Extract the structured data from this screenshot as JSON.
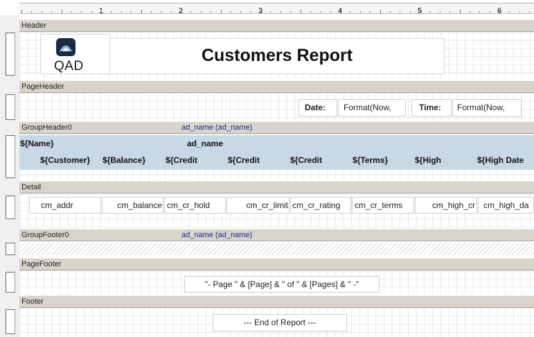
{
  "ruler": {
    "numbers": [
      "1",
      "2",
      "3",
      "4",
      "5",
      "6"
    ]
  },
  "sections": {
    "header": "Header",
    "page_header": "PageHeader",
    "group_header": "GroupHeader0",
    "group_header_expr": "ad_name (ad_name)",
    "detail": "Detail",
    "group_footer": "GroupFooter0",
    "group_footer_expr": "ad_name (ad_name)",
    "page_footer": "PageFooter",
    "footer": "Footer"
  },
  "header": {
    "logo_text": "QAD",
    "title": "Customers Report"
  },
  "page_header": {
    "date_label": "Date:",
    "date_value": "Format(Now,",
    "time_label": "Time:",
    "time_value": "Format(Now,"
  },
  "group_header": {
    "name_field": "${Name}",
    "ad_name_field": "ad_name",
    "columns": [
      "${Customer}",
      "${Balance}",
      "${Credit",
      "${Credit",
      "${Credit",
      "${Terms}",
      "${High",
      "${High Date"
    ]
  },
  "detail": {
    "fields": [
      "cm_addr",
      "cm_balance",
      "cm_cr_hold",
      "cm_cr_limit",
      "cm_cr_rating",
      "cm_cr_terms",
      "cm_high_cr",
      "cm_high_da"
    ]
  },
  "page_footer": {
    "page_expr": "\"- Page \" & [Page] & \" of \" & [Pages] & \" -\""
  },
  "footer": {
    "end_text": "--- End of Report ---"
  },
  "colors": {
    "section_bar": "#d8d4cc",
    "group_band": "#c8d8e6",
    "group_expr_text": "#1a2c8c"
  }
}
